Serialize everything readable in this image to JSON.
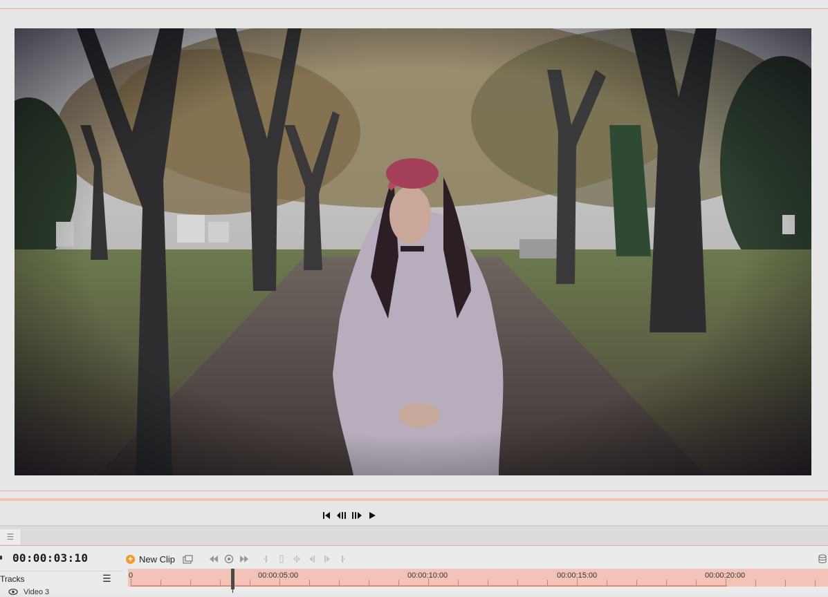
{
  "colors": {
    "accent": "#f0a590",
    "ruler": "#f2c3b6",
    "new_clip_icon": "#f39a2a"
  },
  "viewer": {
    "frame_description_icon": "video-frame"
  },
  "transport": {
    "icons": [
      "skip-to-start-icon",
      "step-back-icon",
      "step-forward-icon",
      "play-icon"
    ]
  },
  "timeline": {
    "timecode": "00:00:03:10",
    "new_clip_label": "New Clip",
    "tracks_label": "Tracks",
    "track_name": "Video 3",
    "ruler_start": "0",
    "ruler_labels": [
      "00:00:05:00",
      "00:00:10:00",
      "00:00:15:00",
      "00:00:20:00"
    ],
    "playhead_time": "00:00:03:10"
  }
}
